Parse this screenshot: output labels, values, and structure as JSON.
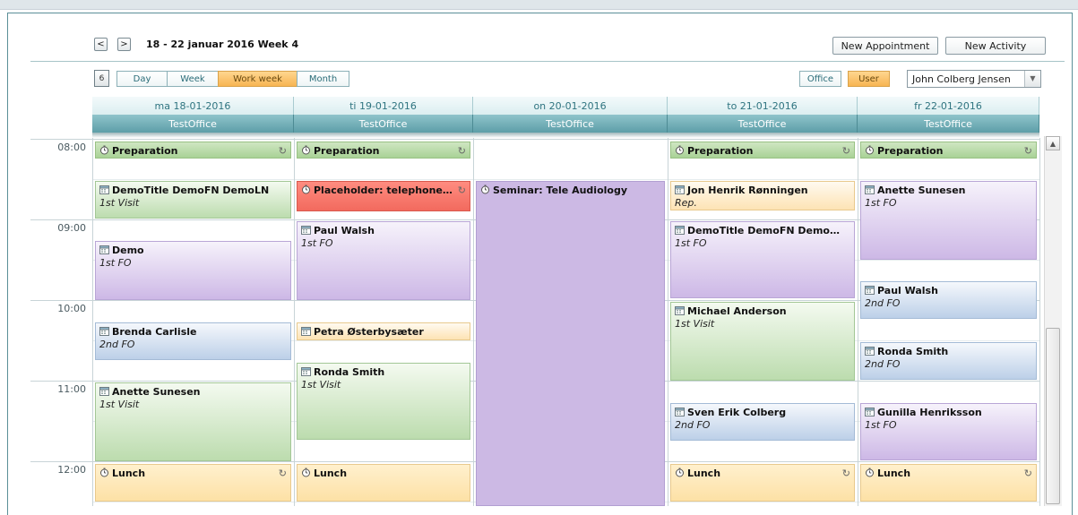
{
  "toolbar": {
    "prev_glyph": "<",
    "next_glyph": ">",
    "date_range": "18 - 22 januar 2016   Week 4",
    "new_appointment": "New Appointment",
    "new_activity": "New Activity"
  },
  "views": {
    "calendar_icon_text": "6",
    "day": "Day",
    "week": "Week",
    "work_week": "Work week",
    "month": "Month",
    "selected": "Work week"
  },
  "scope": {
    "office": "Office",
    "user": "User",
    "selected": "User"
  },
  "user_select": {
    "value": "John Colberg  Jensen"
  },
  "days": [
    {
      "date": "ma  18-01-2016",
      "office": "TestOffice"
    },
    {
      "date": "ti  19-01-2016",
      "office": "TestOffice"
    },
    {
      "date": "on  20-01-2016",
      "office": "TestOffice"
    },
    {
      "date": "to  21-01-2016",
      "office": "TestOffice"
    },
    {
      "date": "fr  22-01-2016",
      "office": "TestOffice"
    }
  ],
  "times": [
    "08:00",
    "09:00",
    "10:00",
    "11:00",
    "12:00"
  ],
  "events": {
    "mon": [
      {
        "title": "Preparation",
        "sub": "",
        "kind": "activity"
      },
      {
        "title": "DemoTitle DemoFN DemoLN",
        "sub": "1st Visit",
        "kind": "appointment"
      },
      {
        "title": "Demo",
        "sub": "1st FO",
        "kind": "appointment"
      },
      {
        "title": "Brenda Carlisle",
        "sub": "2nd FO",
        "kind": "appointment"
      },
      {
        "title": "Anette Sunesen",
        "sub": "1st Visit",
        "kind": "appointment"
      },
      {
        "title": "Lunch",
        "sub": "",
        "kind": "activity"
      }
    ],
    "tue": [
      {
        "title": "Preparation",
        "sub": "",
        "kind": "activity"
      },
      {
        "title": "Placeholder: telephone con...",
        "sub": "",
        "kind": "activity"
      },
      {
        "title": "Paul Walsh",
        "sub": "1st FO",
        "kind": "appointment"
      },
      {
        "title": "Petra Østerbysæter",
        "sub": "",
        "kind": "appointment"
      },
      {
        "title": "Ronda Smith",
        "sub": "1st Visit",
        "kind": "appointment"
      },
      {
        "title": "Lunch",
        "sub": "",
        "kind": "activity"
      }
    ],
    "wed": [
      {
        "title": "Seminar: Tele Audiology",
        "sub": "",
        "kind": "activity"
      }
    ],
    "thu": [
      {
        "title": "Preparation",
        "sub": "",
        "kind": "activity"
      },
      {
        "title": "Jon Henrik  Rønningen",
        "sub": "Rep.",
        "kind": "appointment"
      },
      {
        "title": "DemoTitle DemoFN DemoLN",
        "sub": "1st FO",
        "kind": "appointment"
      },
      {
        "title": "Michael Anderson",
        "sub": "1st Visit",
        "kind": "appointment"
      },
      {
        "title": "Sven  Erik Colberg",
        "sub": "2nd FO",
        "kind": "appointment"
      },
      {
        "title": "Lunch",
        "sub": "",
        "kind": "activity"
      }
    ],
    "fri": [
      {
        "title": "Preparation",
        "sub": "",
        "kind": "activity"
      },
      {
        "title": "Anette Sunesen",
        "sub": "1st FO",
        "kind": "appointment"
      },
      {
        "title": "Paul Walsh",
        "sub": "2nd FO",
        "kind": "appointment"
      },
      {
        "title": "Ronda Smith",
        "sub": "2nd FO",
        "kind": "appointment"
      },
      {
        "title": "Gunilla Henriksson",
        "sub": "1st FO",
        "kind": "appointment"
      },
      {
        "title": "Lunch",
        "sub": "",
        "kind": "activity"
      }
    ]
  },
  "icons": {
    "appointment": "calendar-icon",
    "activity": "stopwatch-icon",
    "recurring": "recurring-icon"
  },
  "colors": {
    "accent_teal": "#5d9ea8",
    "selected_orange": "#f7b552",
    "placeholder_red": "#f26a5e",
    "seminar_purple": "#ccb9e4"
  }
}
